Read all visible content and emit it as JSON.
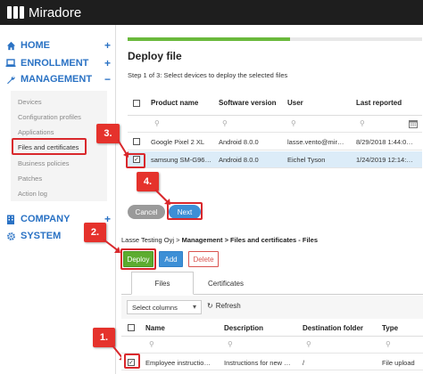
{
  "app": {
    "name": "Miradore"
  },
  "sidebar": {
    "main": [
      {
        "label": "HOME",
        "sign": "+"
      },
      {
        "label": "ENROLLMENT",
        "sign": "+"
      },
      {
        "label": "MANAGEMENT",
        "sign": "−"
      },
      {
        "label": "COMPANY",
        "sign": "+"
      },
      {
        "label": "SYSTEM",
        "sign": ""
      }
    ],
    "management_items": [
      {
        "label": "Devices"
      },
      {
        "label": "Configuration profiles"
      },
      {
        "label": "Applications"
      },
      {
        "label": "Files and certificates"
      },
      {
        "label": "Business policies"
      },
      {
        "label": "Patches"
      },
      {
        "label": "Action log"
      }
    ]
  },
  "callouts": {
    "c1": "1.",
    "c2": "2.",
    "c3": "3.",
    "c4": "4."
  },
  "deploy_dialog": {
    "title": "Deploy file",
    "step": "Step 1 of 3: Select devices to deploy the selected files",
    "progress": 0.55,
    "columns": [
      "Product name",
      "Software version",
      "User",
      "Last reported"
    ],
    "rows": [
      {
        "checked": false,
        "product": "Google Pixel 2 XL",
        "version": "Android 8.0.0",
        "user": "lasse.vento@mir…",
        "reported": "8/29/2018 1:44:0…"
      },
      {
        "checked": true,
        "product": "samsung SM-G96…",
        "version": "Android 8.0.0",
        "user": "Eichel Tyson",
        "reported": "1/24/2019 12:14:…"
      }
    ],
    "cancel_label": "Cancel",
    "next_label": "Next"
  },
  "breadcrumb": {
    "org": "Lasse Testing Oyj",
    "sep": ">",
    "path": "Management > Files and certificates - Files"
  },
  "actions": {
    "deploy": "Deploy",
    "add": "Add",
    "delete": "Delete"
  },
  "tabs": [
    "Files",
    "Certificates"
  ],
  "toolbar": {
    "select_columns": "Select columns",
    "refresh": "Refresh"
  },
  "files_table": {
    "columns": [
      "Name",
      "Description",
      "Destination folder",
      "Type"
    ],
    "rows": [
      {
        "checked": true,
        "name": "Employee instructio…",
        "description": "Instructions for new …",
        "folder": "/",
        "type": "File upload"
      }
    ]
  },
  "colors": {
    "accent": "#2a72c4",
    "callout": "#e5322c",
    "deploy_green": "#5cac2f",
    "selected_row": "#dcecf8"
  },
  "icons": [
    "home-icon",
    "laptop-icon",
    "wrench-icon",
    "building-icon",
    "gear-icon",
    "search-icon",
    "refresh-icon",
    "calendar-icon"
  ]
}
